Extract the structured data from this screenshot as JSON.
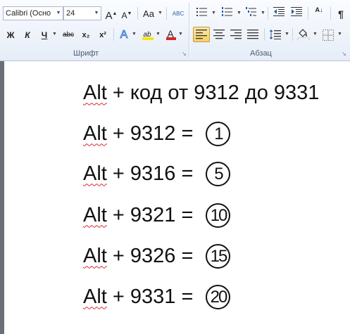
{
  "font_group": {
    "font_name": "Calibri (Осно",
    "font_size": "24",
    "grow_font_glyph": "A",
    "shrink_font_glyph": "A",
    "change_case_label": "Aa",
    "clear_format_glyph": "ABC",
    "bold_label": "Ж",
    "italic_label": "К",
    "underline_label": "Ч",
    "strike_label": "abc",
    "subscript_label": "x₂",
    "superscript_label": "x²",
    "text_effects_glyph": "A",
    "highlight_glyph": "ab",
    "font_color_glyph": "A",
    "label": "Шрифт"
  },
  "paragraph_group": {
    "pilcrow_label": "¶",
    "sort_label": "A↓",
    "label": "Абзац"
  },
  "colors": {
    "highlight": "#f5e50a",
    "font_color": "#d9262b",
    "active_button": "#f8cf63",
    "ribbon": "#e6edf7"
  },
  "document": {
    "lines": [
      {
        "prefix": "Alt",
        "rest": " + код от 9312 до 9331",
        "symbol": ""
      },
      {
        "prefix": "Alt",
        "rest": " + 9312 = ",
        "symbol": "1"
      },
      {
        "prefix": "Alt",
        "rest": " + 9316 = ",
        "symbol": "5"
      },
      {
        "prefix": "Alt",
        "rest": " + 9321 = ",
        "symbol": "10"
      },
      {
        "prefix": "Alt",
        "rest": " + 9326 = ",
        "symbol": "15"
      },
      {
        "prefix": "Alt",
        "rest": " + 9331 = ",
        "symbol": "20"
      }
    ]
  }
}
